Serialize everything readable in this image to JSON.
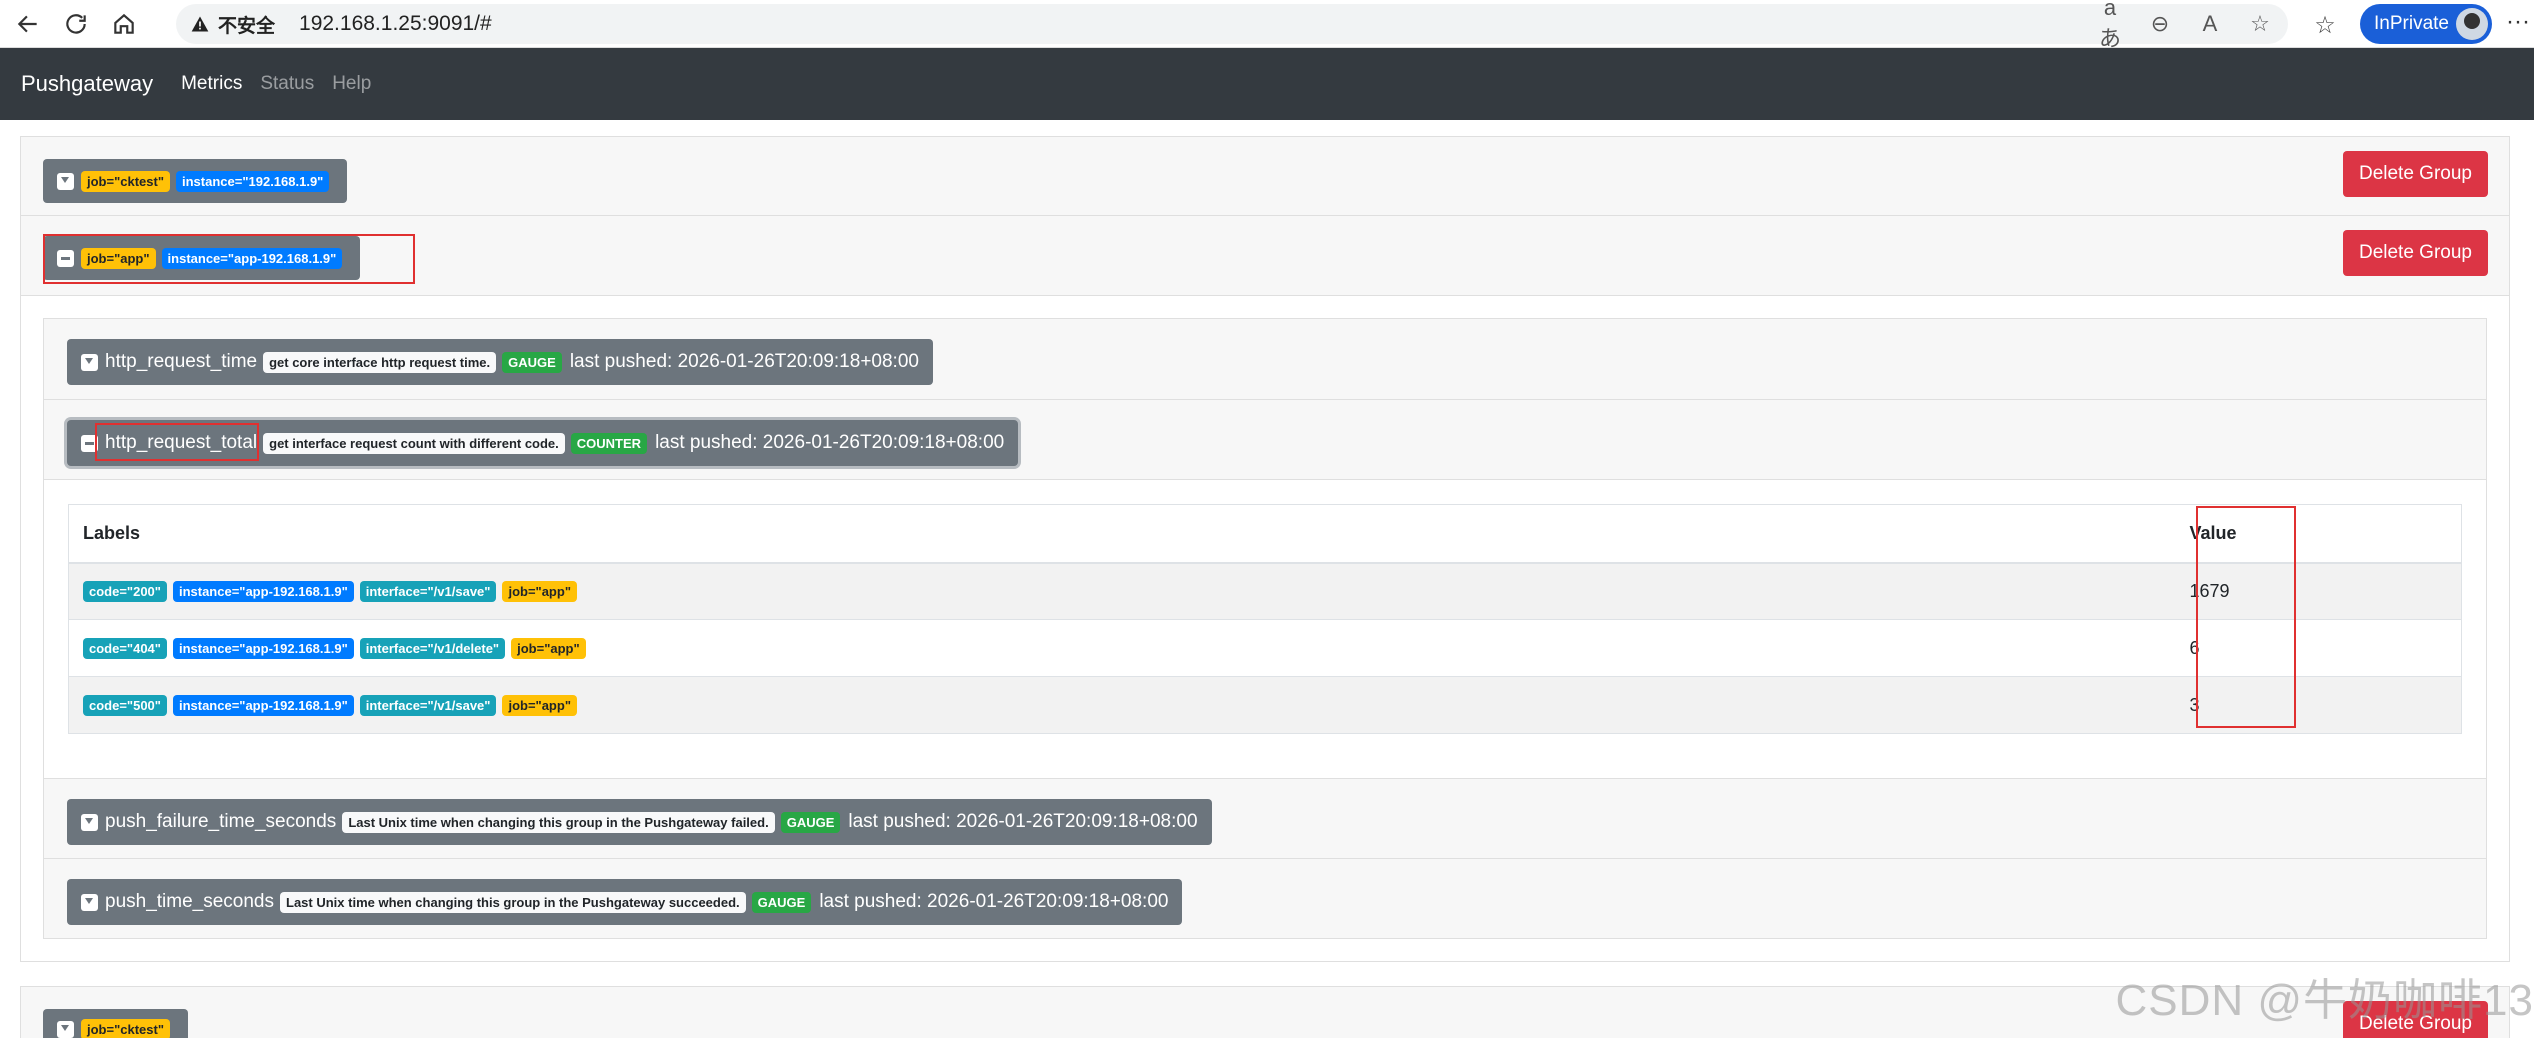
{
  "browser": {
    "security_label": "不安全",
    "url": "192.168.1.25:9091/#",
    "inprivate_label": "InPrivate"
  },
  "navbar": {
    "brand": "Pushgateway",
    "links": [
      "Metrics",
      "Status",
      "Help"
    ]
  },
  "groups": [
    {
      "labels": [
        {
          "text": "job=\"cktest\"",
          "color": "warning"
        },
        {
          "text": "instance=\"192.168.1.9\"",
          "color": "primary"
        }
      ],
      "delete_label": "Delete Group"
    },
    {
      "labels": [
        {
          "text": "job=\"app\"",
          "color": "warning"
        },
        {
          "text": "instance=\"app-192.168.1.9\"",
          "color": "primary"
        }
      ],
      "delete_label": "Delete Group",
      "metrics": [
        {
          "name": "http_request_time",
          "help": "get core interface http request time.",
          "type": "GAUGE",
          "last_pushed": "last pushed: 2026-01-26T20:09:18+08:00"
        },
        {
          "name": "http_request_total",
          "help": "get interface request count with different code.",
          "type": "COUNTER",
          "last_pushed": "last pushed: 2026-01-26T20:09:18+08:00",
          "table": {
            "headers": [
              "Labels",
              "Value"
            ],
            "rows": [
              {
                "labels": [
                  "code=\"200\"",
                  "instance=\"app-192.168.1.9\"",
                  "interface=\"/v1/save\"",
                  "job=\"app\""
                ],
                "value": "1679"
              },
              {
                "labels": [
                  "code=\"404\"",
                  "instance=\"app-192.168.1.9\"",
                  "interface=\"/v1/delete\"",
                  "job=\"app\""
                ],
                "value": "6"
              },
              {
                "labels": [
                  "code=\"500\"",
                  "instance=\"app-192.168.1.9\"",
                  "interface=\"/v1/save\"",
                  "job=\"app\""
                ],
                "value": "3"
              }
            ]
          }
        },
        {
          "name": "push_failure_time_seconds",
          "help": "Last Unix time when changing this group in the Pushgateway failed.",
          "type": "GAUGE",
          "last_pushed": "last pushed: 2026-01-26T20:09:18+08:00"
        },
        {
          "name": "push_time_seconds",
          "help": "Last Unix time when changing this group in the Pushgateway succeeded.",
          "type": "GAUGE",
          "last_pushed": "last pushed: 2026-01-26T20:09:18+08:00"
        }
      ]
    },
    {
      "labels": [
        {
          "text": "job=\"cktest\"",
          "color": "warning"
        }
      ],
      "delete_label": "Delete Group"
    }
  ],
  "watermark": "CSDN @牛奶咖啡13"
}
